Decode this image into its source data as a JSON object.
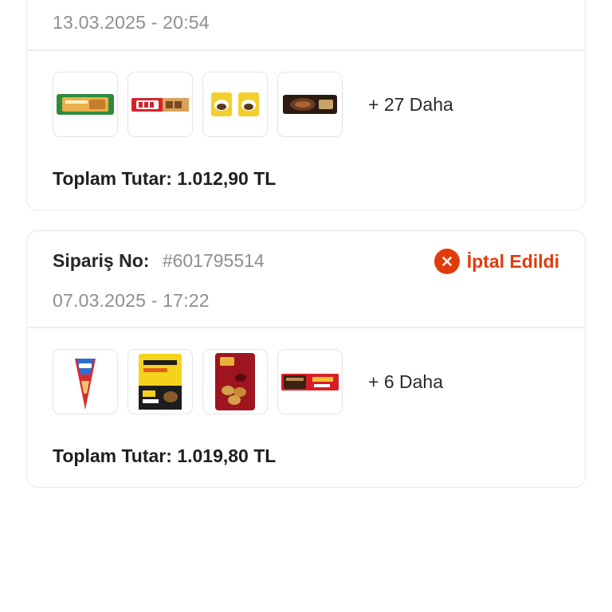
{
  "orders": [
    {
      "date": "13.03.2025 - 20:54",
      "products": [
        {
          "icon": "wafer-bar-green-product"
        },
        {
          "icon": "dido-chocolate-bar-product"
        },
        {
          "icon": "cake-pack-yellow-product"
        },
        {
          "icon": "chocolate-cookie-pack-product"
        }
      ],
      "more": "+ 27 Daha",
      "total": "Toplam Tutar: 1.012,90 TL"
    },
    {
      "order_label": "Sipariş No:",
      "order_number": "#601795514",
      "status": "İptal Edildi",
      "date": "07.03.2025 - 17:22",
      "products": [
        {
          "icon": "ice-cream-cone-product"
        },
        {
          "icon": "biscuit-4-pack-product"
        },
        {
          "icon": "eti-chocolate-bag-product"
        },
        {
          "icon": "chocolate-wafer-red-product"
        }
      ],
      "more": "+ 6 Daha",
      "total": "Toplam Tutar: 1.019,80 TL"
    }
  ],
  "colors": {
    "status_cancelled": "#e13b0c",
    "text_primary": "#262626",
    "text_secondary": "#8e8e93",
    "border": "#e9e9ee"
  }
}
